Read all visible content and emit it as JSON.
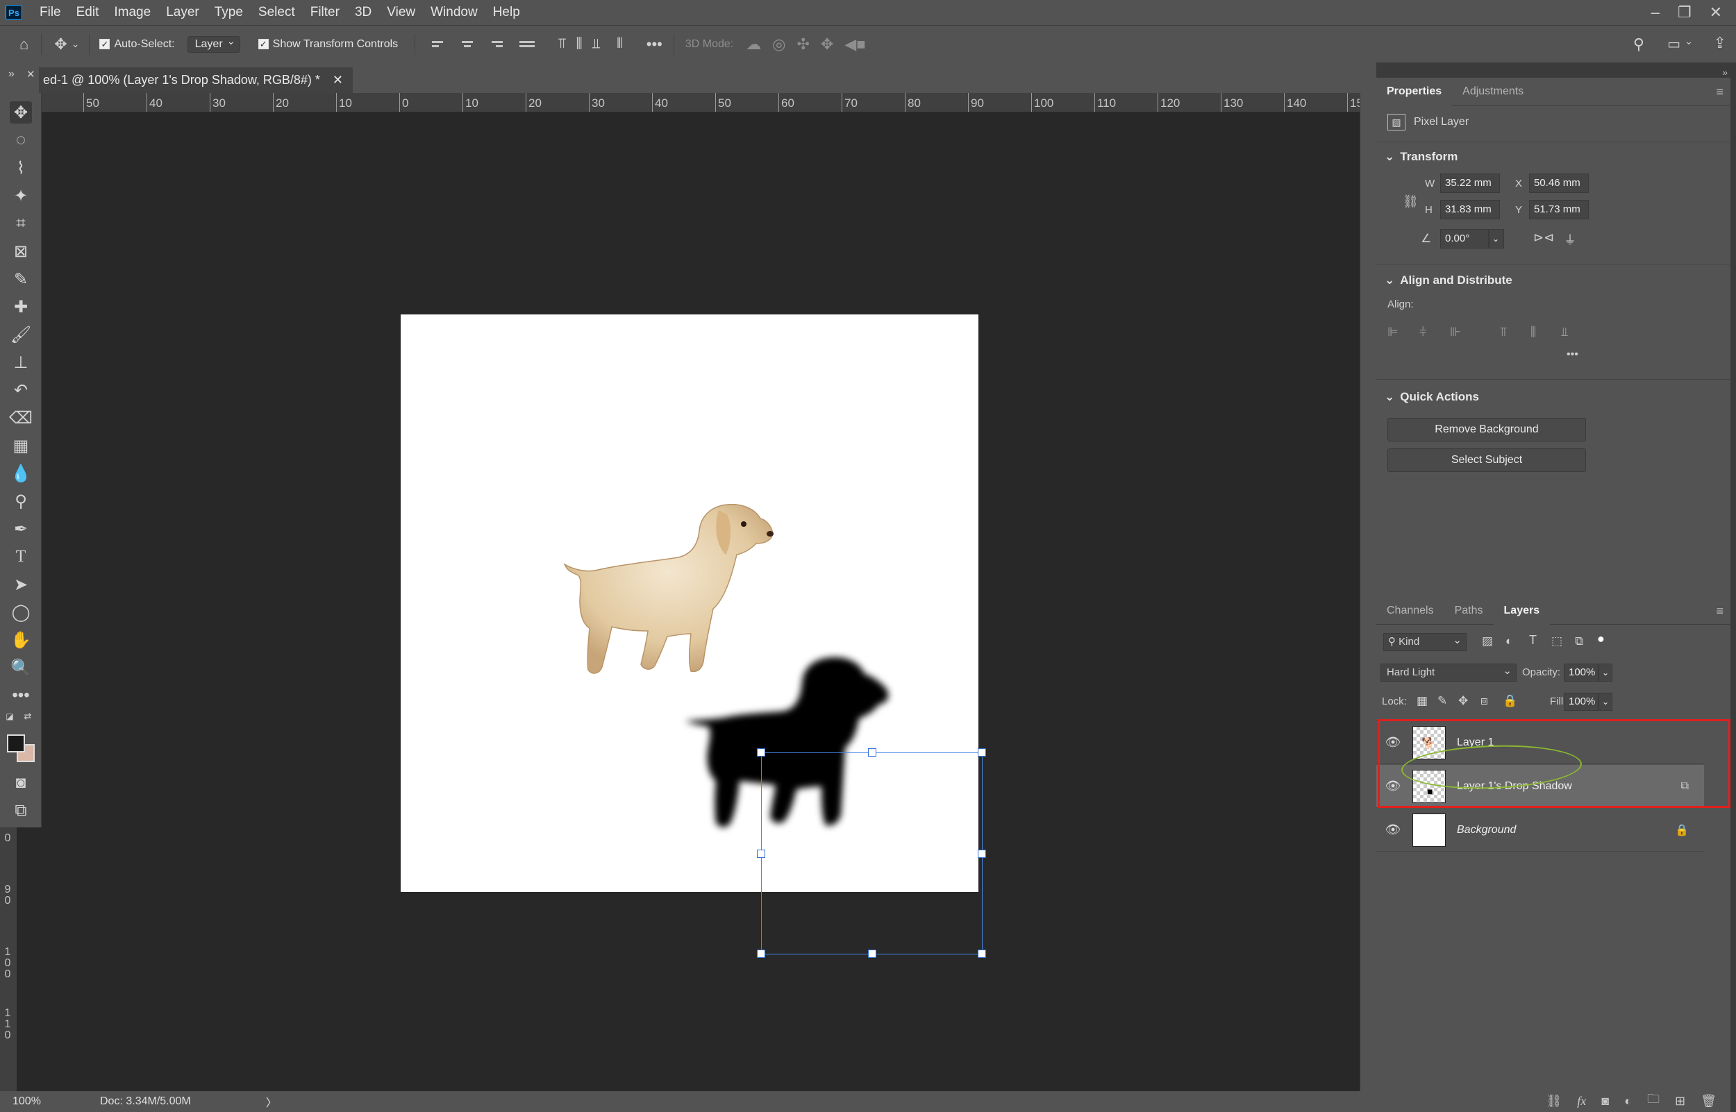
{
  "app": {
    "logo_text": "Ps"
  },
  "menubar": {
    "items": [
      "File",
      "Edit",
      "Image",
      "Layer",
      "Type",
      "Select",
      "Filter",
      "3D",
      "View",
      "Window",
      "Help"
    ]
  },
  "options": {
    "auto_select_label": "Auto-Select:",
    "auto_select_target": "Layer",
    "show_transform_label": "Show Transform Controls",
    "three_d_mode_label": "3D Mode:"
  },
  "document": {
    "tab_title": "ed-1 @ 100% (Layer 1's Drop Shadow, RGB/8#) *"
  },
  "ruler": {
    "h_labels": [
      "50",
      "40",
      "30",
      "20",
      "10",
      "0",
      "10",
      "20",
      "30",
      "40",
      "50",
      "60",
      "70",
      "80",
      "90",
      "100",
      "110",
      "120",
      "130",
      "140",
      "15"
    ],
    "v_labels": [
      "0",
      "9",
      "0",
      "1",
      "0",
      "0",
      "1",
      "1",
      "0"
    ]
  },
  "status": {
    "zoom": "100%",
    "doc_info": "Doc: 3.34M/5.00M",
    "arrow": "〉"
  },
  "properties": {
    "tabs": [
      "Properties",
      "Adjustments"
    ],
    "layer_kind": "Pixel Layer",
    "transform": {
      "title": "Transform",
      "w_label": "W",
      "w": "35.22 mm",
      "h_label": "H",
      "h": "31.83 mm",
      "x_label": "X",
      "x": "50.46 mm",
      "y_label": "Y",
      "y": "51.73 mm",
      "angle": "0.00°"
    },
    "align": {
      "title": "Align and Distribute",
      "label": "Align:"
    },
    "quick_actions": {
      "title": "Quick Actions",
      "remove_bg": "Remove Background",
      "select_subject": "Select Subject"
    }
  },
  "layers_panel": {
    "tabs": [
      "Channels",
      "Paths",
      "Layers"
    ],
    "filter_kind": "Kind",
    "blend_mode": "Hard Light",
    "opacity_label": "Opacity:",
    "opacity": "100%",
    "lock_label": "Lock:",
    "fill_label": "Fill:",
    "fill": "100%",
    "layers": [
      {
        "name": "Layer 1",
        "selected": false
      },
      {
        "name": "Layer 1's Drop Shadow",
        "selected": true
      },
      {
        "name": "Background",
        "selected": false
      }
    ]
  },
  "colors": {
    "selection": "#4a86e8",
    "highlight_red": "#e0201f",
    "highlight_green": "#8ab830",
    "foreground": "#1a1a1a",
    "background": "#d9b8a8"
  }
}
